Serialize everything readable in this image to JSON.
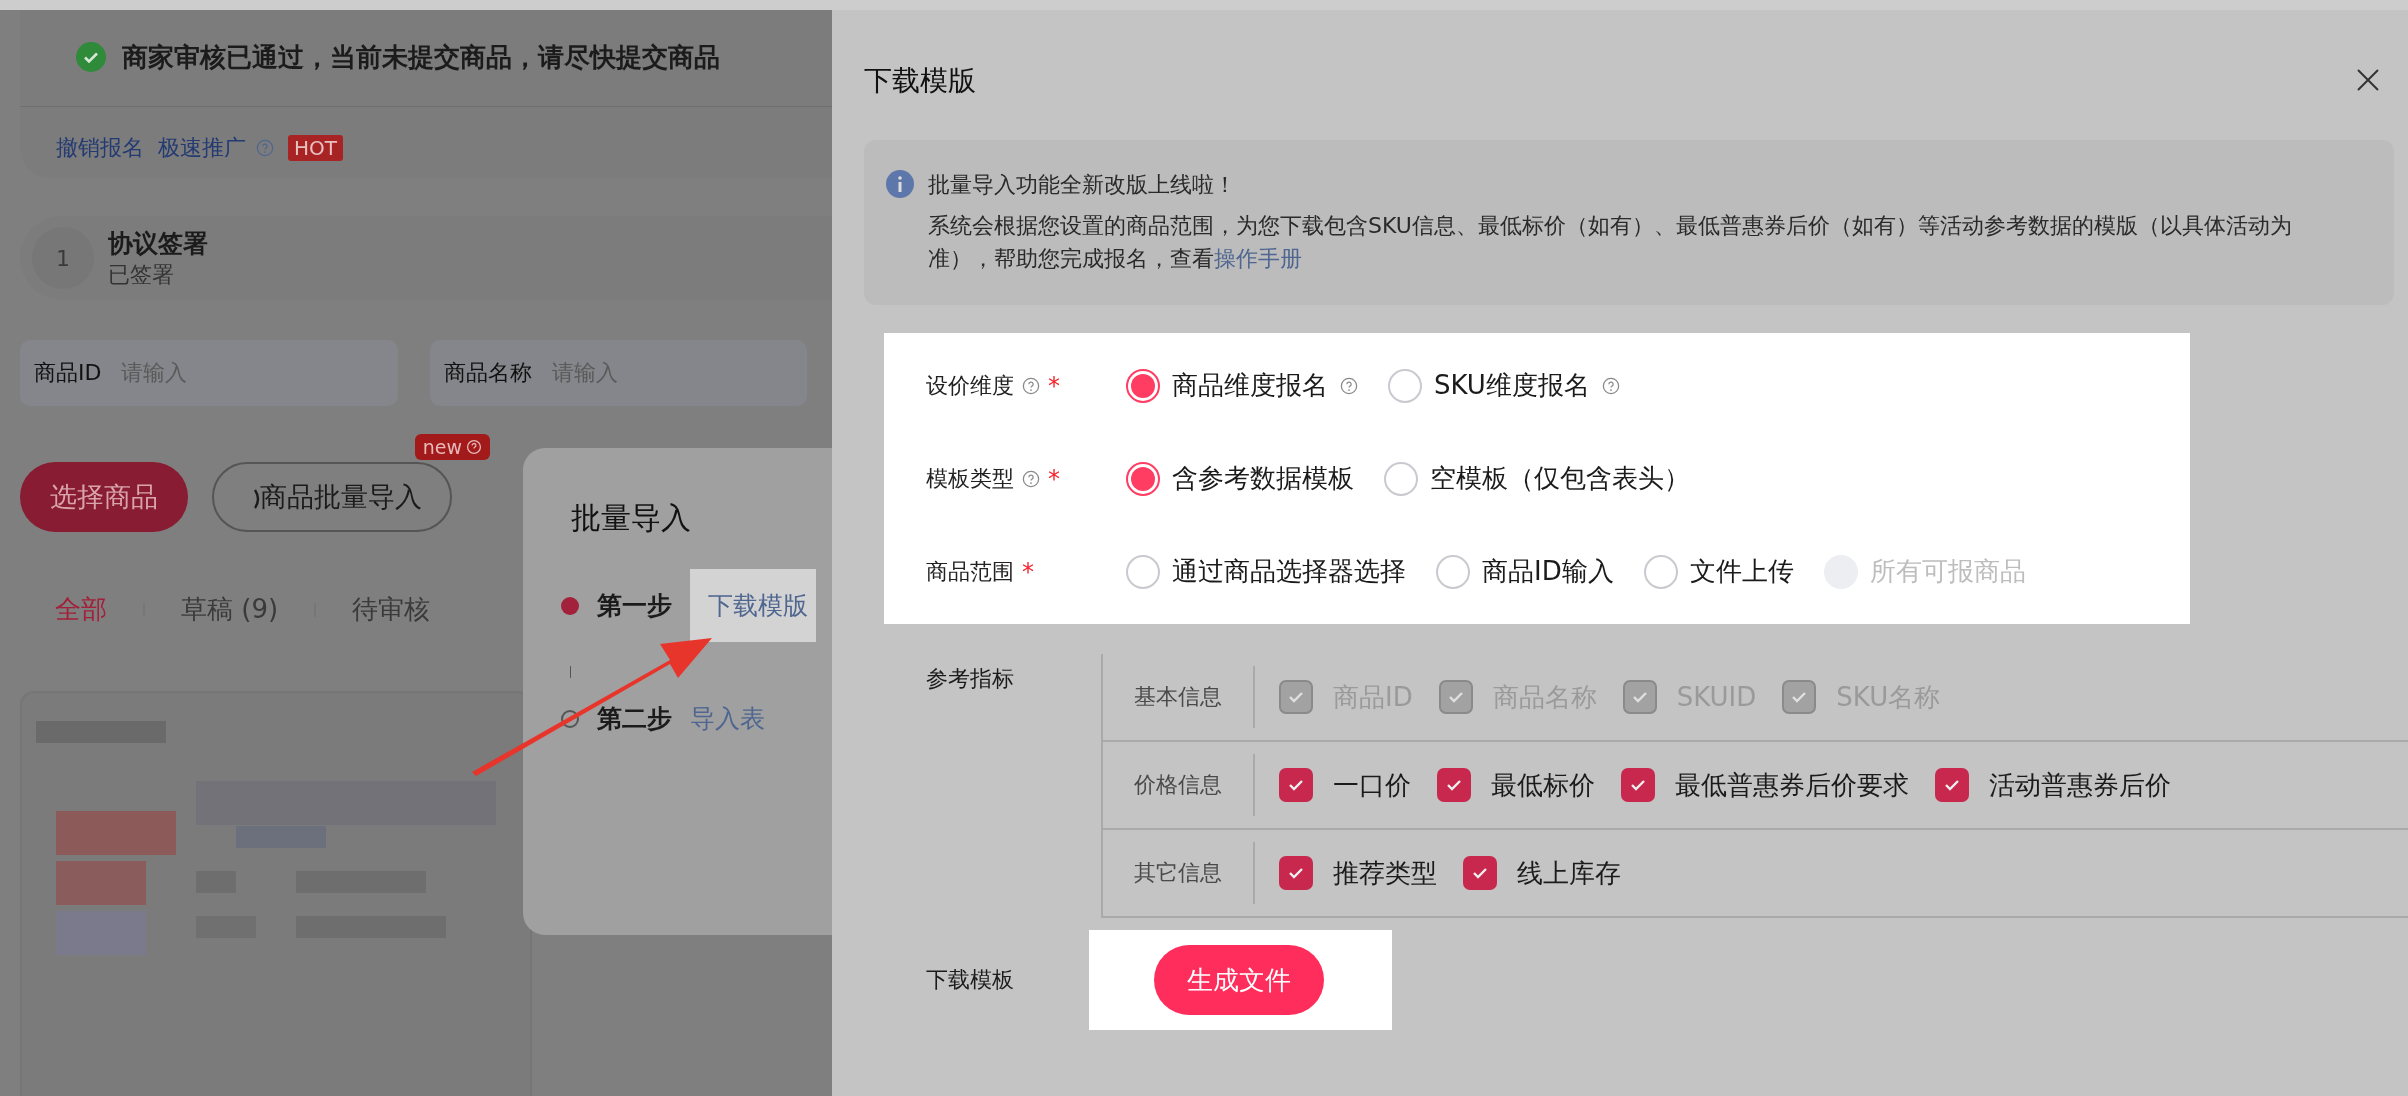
{
  "notice": {
    "text": "商家审核已通过，当前未提交商品，请尽快提交商品"
  },
  "actions": [
    {
      "label": "撤销报名",
      "help": false
    },
    {
      "label": "极速推广",
      "help": true
    }
  ],
  "hot_badge": "HOT",
  "step": {
    "number": "1",
    "title": "协议签署",
    "status": "已签署"
  },
  "filters": [
    {
      "label": "商品ID",
      "placeholder": "请输入"
    },
    {
      "label": "商品名称",
      "placeholder": "请输入"
    }
  ],
  "buttons": [
    {
      "label": "选择商品",
      "kind": "primary"
    },
    {
      "label": "商品批量导入",
      "kind": "outline",
      "badge": "new"
    }
  ],
  "tabs": [
    {
      "label": "全部",
      "selected": true
    },
    {
      "label": "草稿 (9)",
      "selected": false
    },
    {
      "label": "待审核",
      "selected": false
    }
  ],
  "popover": {
    "title": "批量导入",
    "steps": [
      {
        "label": "第一步",
        "link": "下载模版",
        "active": true
      },
      {
        "label": "第二步",
        "link": "导入表",
        "active": false
      }
    ]
  },
  "drawer": {
    "title": "下载模版",
    "info": {
      "title": "批量导入功能全新改版上线啦！",
      "body": "系统会根据您设置的商品范围，为您下载包含SKU信息、最低标价（如有）、最低普惠券后价（如有）等活动参考数据的模版（以具体活动为准），帮助您完成报名，查看",
      "link": "操作手册"
    },
    "fields": [
      {
        "label": "设价维度",
        "help": true,
        "required": "*",
        "options": [
          {
            "label": "商品维度报名",
            "selected": true,
            "help": true,
            "disabled": false
          },
          {
            "label": "SKU维度报名",
            "selected": false,
            "help": true,
            "disabled": false
          }
        ]
      },
      {
        "label": "模板类型",
        "help": true,
        "required": "*",
        "options": [
          {
            "label": "含参考数据模板",
            "selected": true,
            "help": false,
            "disabled": false
          },
          {
            "label": "空模板（仅包含表头）",
            "selected": false,
            "help": false,
            "disabled": false
          }
        ]
      },
      {
        "label": "商品范围",
        "help": false,
        "required": "*",
        "options": [
          {
            "label": "通过商品选择器选择",
            "selected": false,
            "help": false,
            "disabled": false
          },
          {
            "label": "商品ID输入",
            "selected": false,
            "help": false,
            "disabled": false
          },
          {
            "label": "文件上传",
            "selected": false,
            "help": false,
            "disabled": false
          },
          {
            "label": "所有可报商品",
            "selected": false,
            "help": false,
            "disabled": true
          }
        ]
      }
    ],
    "indicators": {
      "label": "参考指标",
      "groups": [
        {
          "name": "基本信息",
          "items": [
            {
              "label": "商品ID",
              "checked": true,
              "disabled": true
            },
            {
              "label": "商品名称",
              "checked": true,
              "disabled": true
            },
            {
              "label": "SKUID",
              "checked": true,
              "disabled": true
            },
            {
              "label": "SKU名称",
              "checked": true,
              "disabled": true
            }
          ]
        },
        {
          "name": "价格信息",
          "items": [
            {
              "label": "一口价",
              "checked": true,
              "disabled": false
            },
            {
              "label": "最低标价",
              "checked": true,
              "disabled": false
            },
            {
              "label": "最低普惠券后价要求",
              "checked": true,
              "disabled": false
            },
            {
              "label": "活动普惠券后价",
              "checked": true,
              "disabled": false
            }
          ]
        },
        {
          "name": "其它信息",
          "items": [
            {
              "label": "推荐类型",
              "checked": true,
              "disabled": false
            },
            {
              "label": "线上库存",
              "checked": true,
              "disabled": false
            }
          ]
        }
      ]
    },
    "download": {
      "label": "下载模板",
      "button": "生成文件"
    }
  }
}
